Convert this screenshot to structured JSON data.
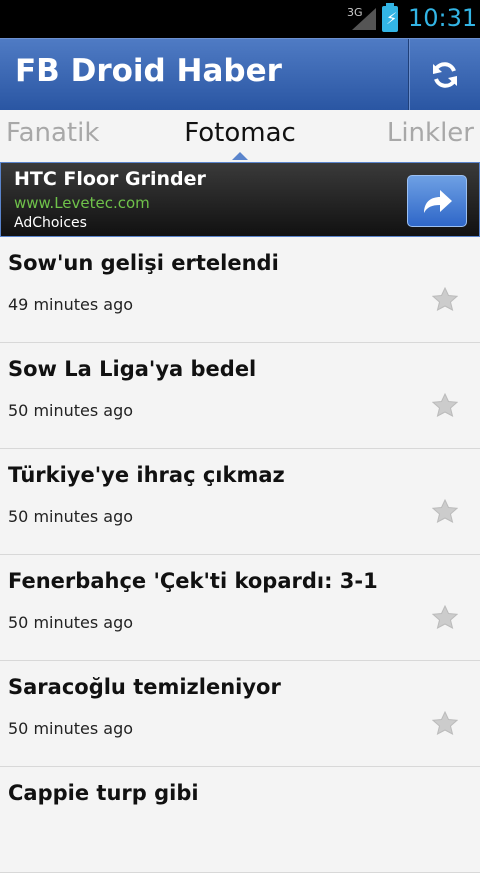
{
  "status": {
    "network": "3G",
    "time": "10:31"
  },
  "app": {
    "title": "FB Droid Haber"
  },
  "tabs": {
    "left": "Fanatik",
    "center": "Fotomac",
    "right": "Linkler"
  },
  "ad": {
    "headline": "HTC Floor Grinder",
    "url": "www.Levetec.com",
    "choices": "AdChoices"
  },
  "articles": [
    {
      "title": "Sow'un gelişi ertelendi",
      "time": "49 minutes ago"
    },
    {
      "title": "Sow La Liga'ya bedel",
      "time": "50 minutes ago"
    },
    {
      "title": "Türkiye'ye ihraç çıkmaz",
      "time": "50 minutes ago"
    },
    {
      "title": "Fenerbahçe 'Çek'ti kopardı: 3-1",
      "time": "50 minutes ago"
    },
    {
      "title": "Saracoğlu temizleniyor",
      "time": "50 minutes ago"
    },
    {
      "title": "Cappie turp gibi",
      "time": ""
    }
  ],
  "colors": {
    "actionbar": "#3b68b6",
    "accent": "#33b5e5",
    "ad_url": "#6fc24a"
  }
}
